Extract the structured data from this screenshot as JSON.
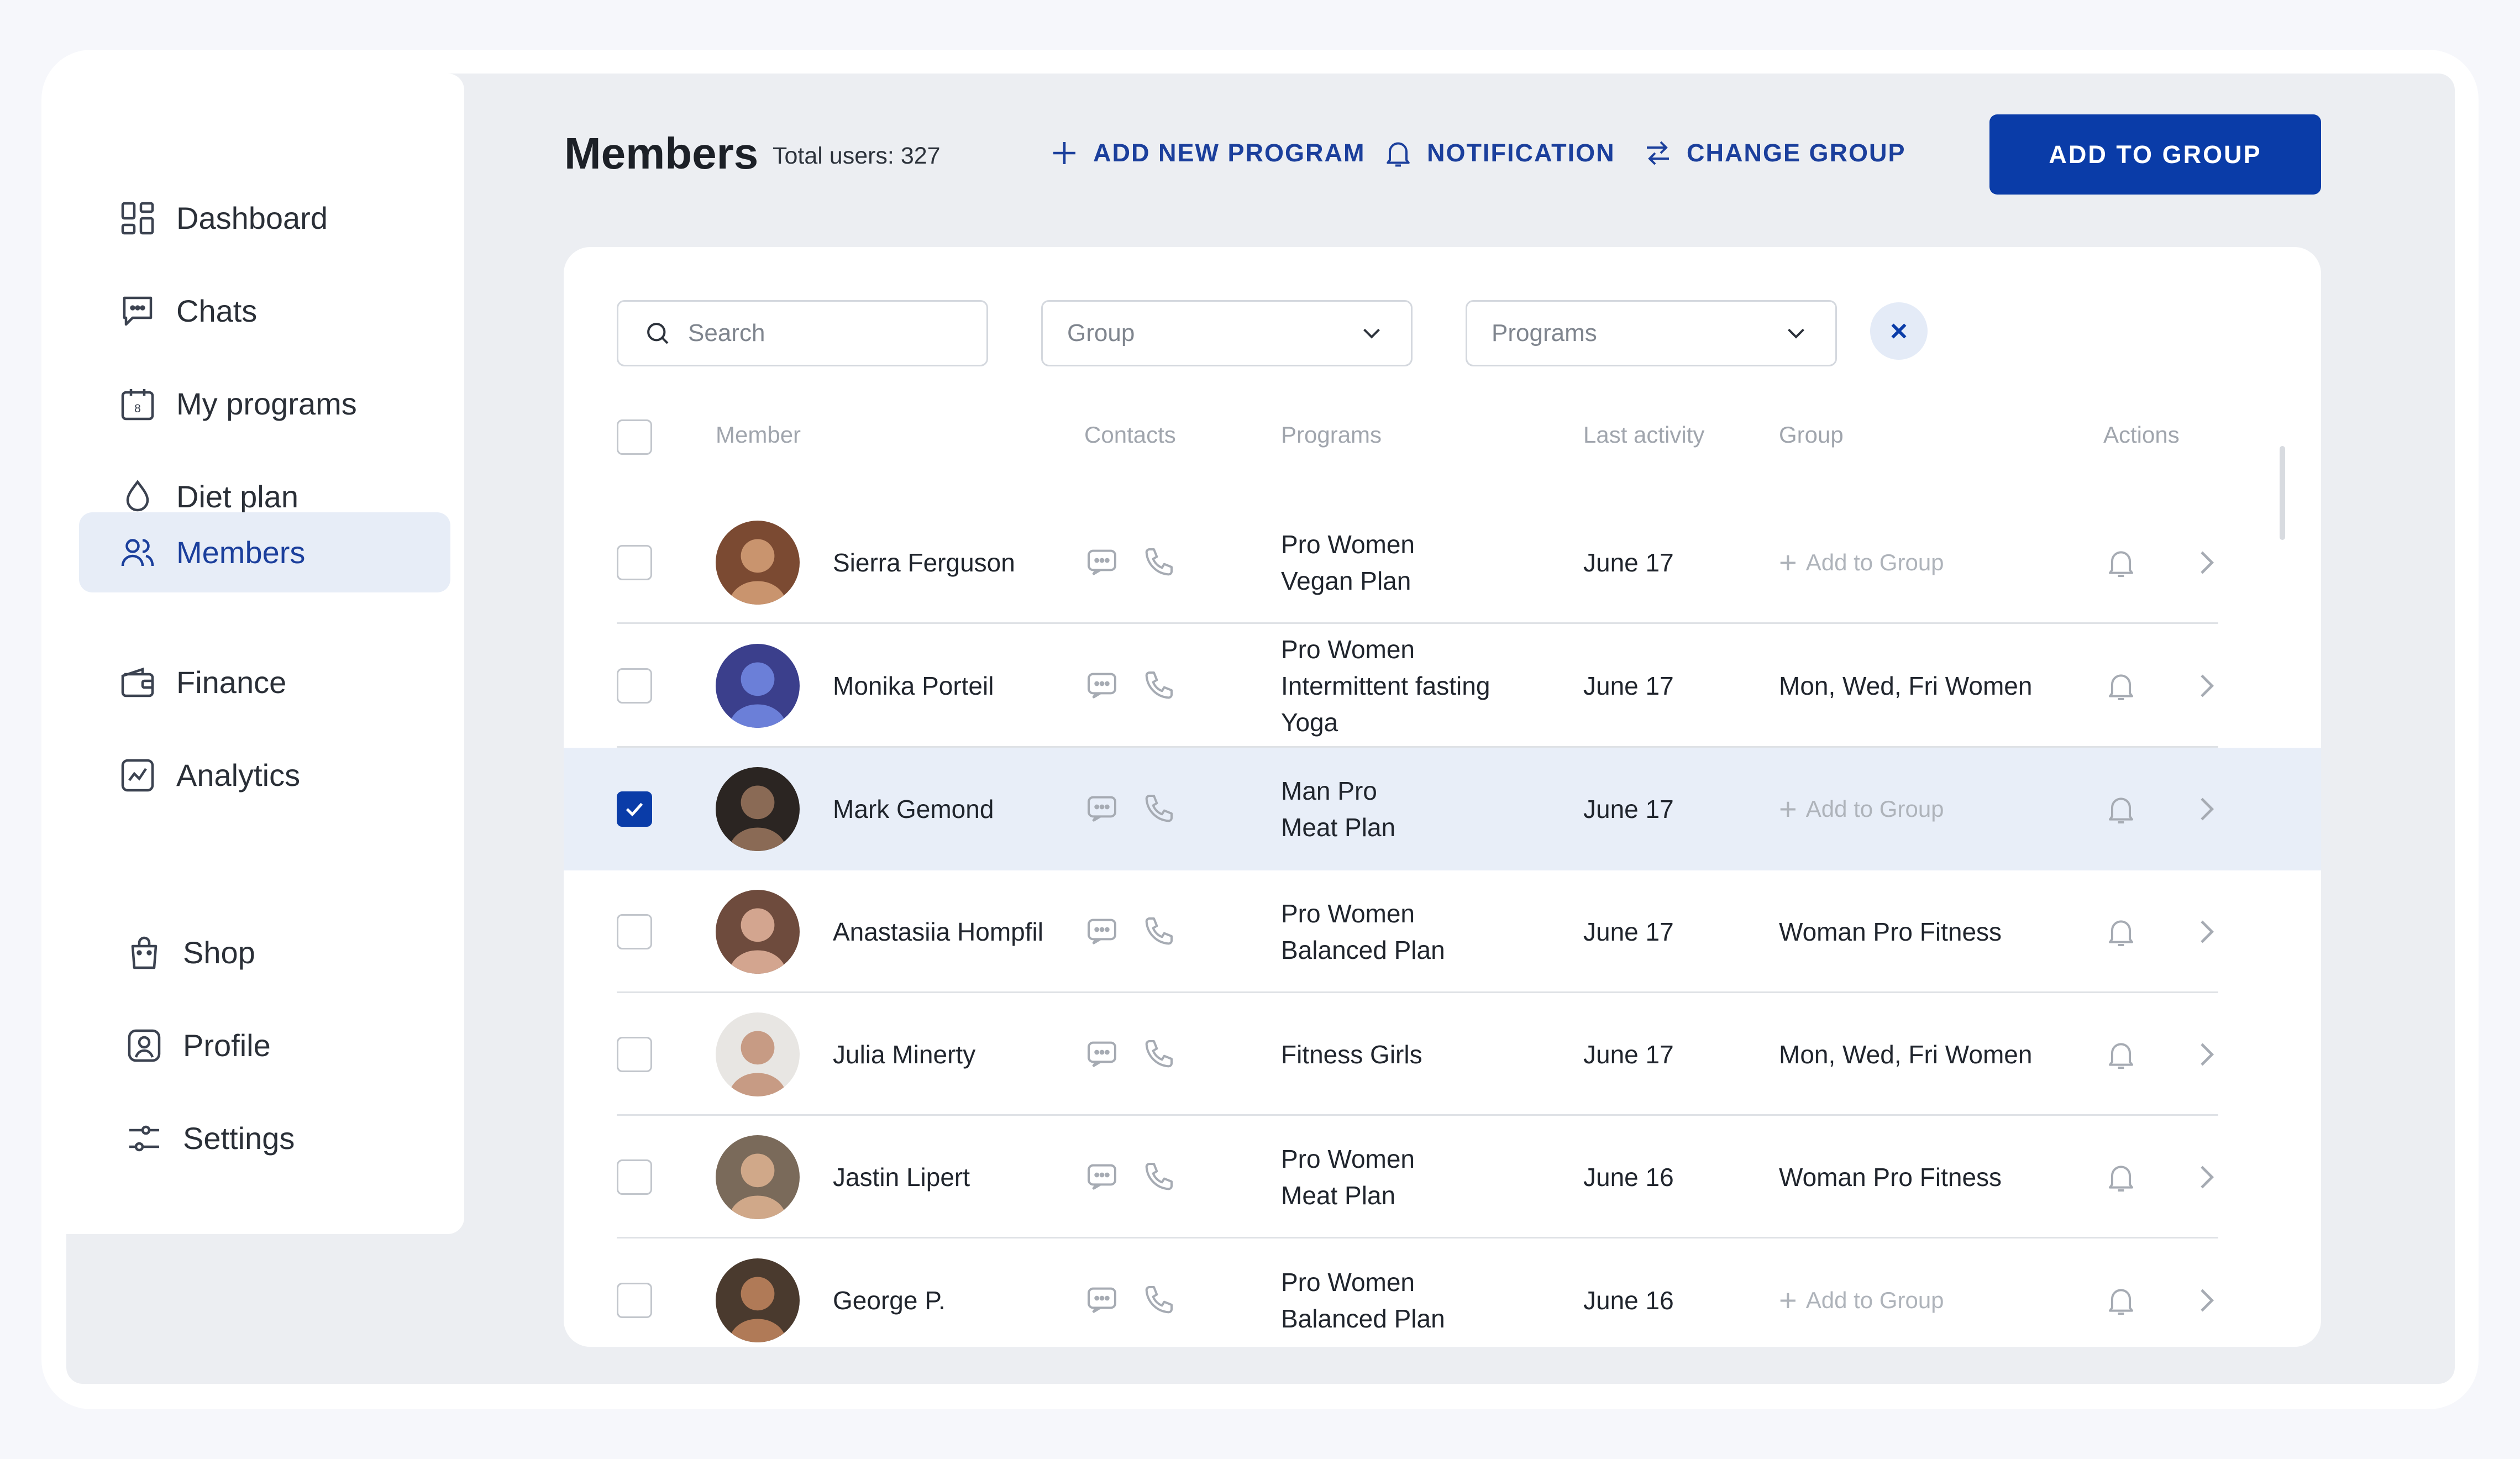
{
  "sidebar": {
    "items": [
      {
        "label": "Dashboard",
        "icon": "dashboard-icon"
      },
      {
        "label": "Chats",
        "icon": "chat-icon"
      },
      {
        "label": "My programs",
        "icon": "calendar-icon"
      },
      {
        "label": "Diet plan",
        "icon": "drop-icon"
      },
      {
        "label": "Members",
        "icon": "members-icon",
        "active": true
      },
      {
        "label": "Finance",
        "icon": "wallet-icon"
      },
      {
        "label": "Analytics",
        "icon": "analytics-icon"
      }
    ],
    "bottom_items": [
      {
        "label": "Shop",
        "icon": "shopping-bag-icon"
      },
      {
        "label": "Profile",
        "icon": "profile-icon"
      },
      {
        "label": "Settings",
        "icon": "sliders-icon"
      }
    ]
  },
  "header": {
    "title": "Members",
    "total_users": "Total users: 327",
    "add_program": "ADD NEW PROGRAM",
    "notification": "NOTIFICATION",
    "change_group": "CHANGE GROUP",
    "add_to_group": "ADD TO GROUP"
  },
  "filters": {
    "search_placeholder": "Search",
    "group_placeholder": "Group",
    "programs_placeholder": "Programs"
  },
  "table": {
    "columns": [
      "Member",
      "Contacts",
      "Programs",
      "Last activity",
      "Group",
      "Actions"
    ],
    "rows": [
      {
        "name": "Sierra Ferguson",
        "programs": [
          "Pro Women",
          "Vegan Plan"
        ],
        "last_activity": "June 17",
        "group": "",
        "selected": false
      },
      {
        "name": "Monika Porteil",
        "programs": [
          "Pro Women",
          "Intermittent fasting",
          "Yoga"
        ],
        "last_activity": "June 17",
        "group": "Mon, Wed, Fri Women",
        "selected": false
      },
      {
        "name": "Mark Gemond",
        "programs": [
          "Man Pro",
          "Meat Plan"
        ],
        "last_activity": "June 17",
        "group": "",
        "selected": true
      },
      {
        "name": "Anastasiia Hompfil",
        "programs": [
          "Pro Women",
          "Balanced Plan"
        ],
        "last_activity": "June 17",
        "group": "Woman Pro Fitness",
        "selected": false
      },
      {
        "name": "Julia Minerty",
        "programs": [
          "Fitness Girls"
        ],
        "last_activity": "June 17",
        "group": "Mon, Wed, Fri Women",
        "selected": false
      },
      {
        "name": "Jastin Lipert",
        "programs": [
          "Pro Women",
          "Meat Plan"
        ],
        "last_activity": "June 16",
        "group": "Woman Pro Fitness",
        "selected": false
      },
      {
        "name": "George P.",
        "programs": [
          "Pro Women",
          "Balanced Plan"
        ],
        "last_activity": "June 16",
        "group": "",
        "selected": false
      }
    ],
    "add_to_group_label": "Add to Group"
  },
  "colors": {
    "accent": "#0a3ca8",
    "active_nav_bg": "#e7edf7",
    "selected_row_bg": "#e8eef8"
  }
}
